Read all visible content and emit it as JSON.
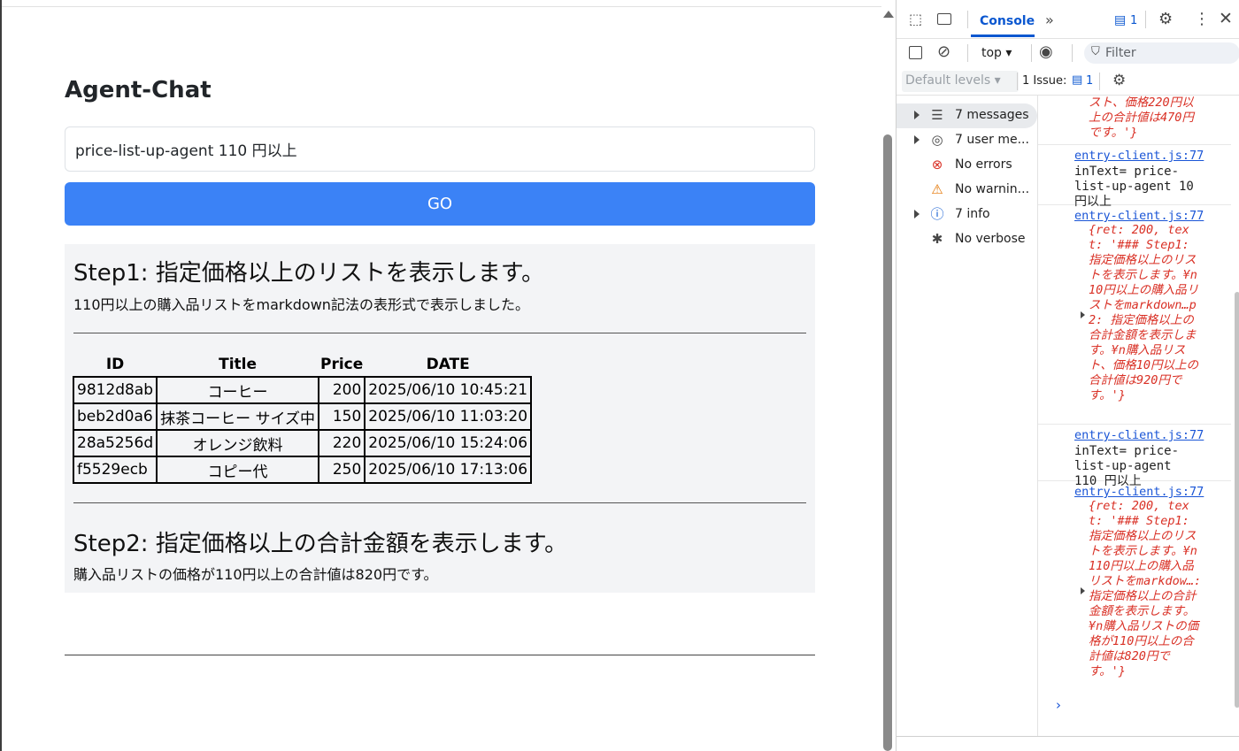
{
  "app": {
    "title": "Agent-Chat",
    "input_value": "price-list-up-agent 110 円以上",
    "go_label": "GO"
  },
  "result": {
    "step1_heading": "Step1: 指定価格以上のリストを表示します。",
    "step1_text": "110円以上の購入品リストをmarkdown記法の表形式で表示しました。",
    "table": {
      "headers": [
        "ID",
        "Title",
        "Price",
        "DATE"
      ],
      "rows": [
        [
          "9812d8ab",
          "コーヒー",
          "200",
          "2025/06/10 10:45:21"
        ],
        [
          "beb2d0a6",
          "抹茶コーヒー サイズ中",
          "150",
          "2025/06/10 11:03:20"
        ],
        [
          "28a5256d",
          "オレンジ飲料",
          "220",
          "2025/06/10 15:24:06"
        ],
        [
          "f5529ecb",
          "コピー代",
          "250",
          "2025/06/10 17:13:06"
        ]
      ]
    },
    "step2_heading": "Step2: 指定価格以上の合計金額を表示します。",
    "step2_text": "購入品リストの価格が110円以上の合計値は820円です。"
  },
  "devtools": {
    "tab_console": "Console",
    "issues_badge": "1",
    "context": "top ▾",
    "filter_placeholder": "Filter",
    "levels": "Default levels ▾",
    "issue_label": "1 Issue:",
    "issue_count": "1",
    "sidebar": [
      {
        "label": "7 messages",
        "icon": "list-icon"
      },
      {
        "label": "7 user me...",
        "icon": "user-icon"
      },
      {
        "label": "No errors",
        "icon": "error-icon"
      },
      {
        "label": "No warnin...",
        "icon": "warning-icon"
      },
      {
        "label": "7 info",
        "icon": "info-icon"
      },
      {
        "label": "No verbose",
        "icon": "bug-icon"
      }
    ],
    "log": {
      "top_fragment": "スト、価格220円以上の合計値は470円です。'}",
      "src1": "entry-client.js:77",
      "intext1": "inText= price-list-up-agent 10 円以上",
      "src2": "entry-client.js:77",
      "obj1": "{ret: 200, text: '### Step1: 指定価格以上のリストを表示します。¥n10円以上の購入品リストをmarkdown…p2: 指定価格以上の合計金額を表示します。¥n購入品リスト、価格10円以上の合計値は920円です。'}",
      "src3": "entry-client.js:77",
      "intext2": "inText= price-list-up-agent 110 円以上",
      "src4": "entry-client.js:77",
      "obj2": "{ret: 200, text: '### Step1: 指定価格以上のリストを表示します。¥n110円以上の購入品リストをmarkdow…: 指定価格以上の合計金額を表示します。¥n購入品リストの価格が110円以上の合計値は820円です。'}",
      "caret": "›"
    },
    "colors": {
      "accent": "#0b57d0",
      "error_text": "#d93025",
      "go_button": "#3b82f6"
    }
  }
}
